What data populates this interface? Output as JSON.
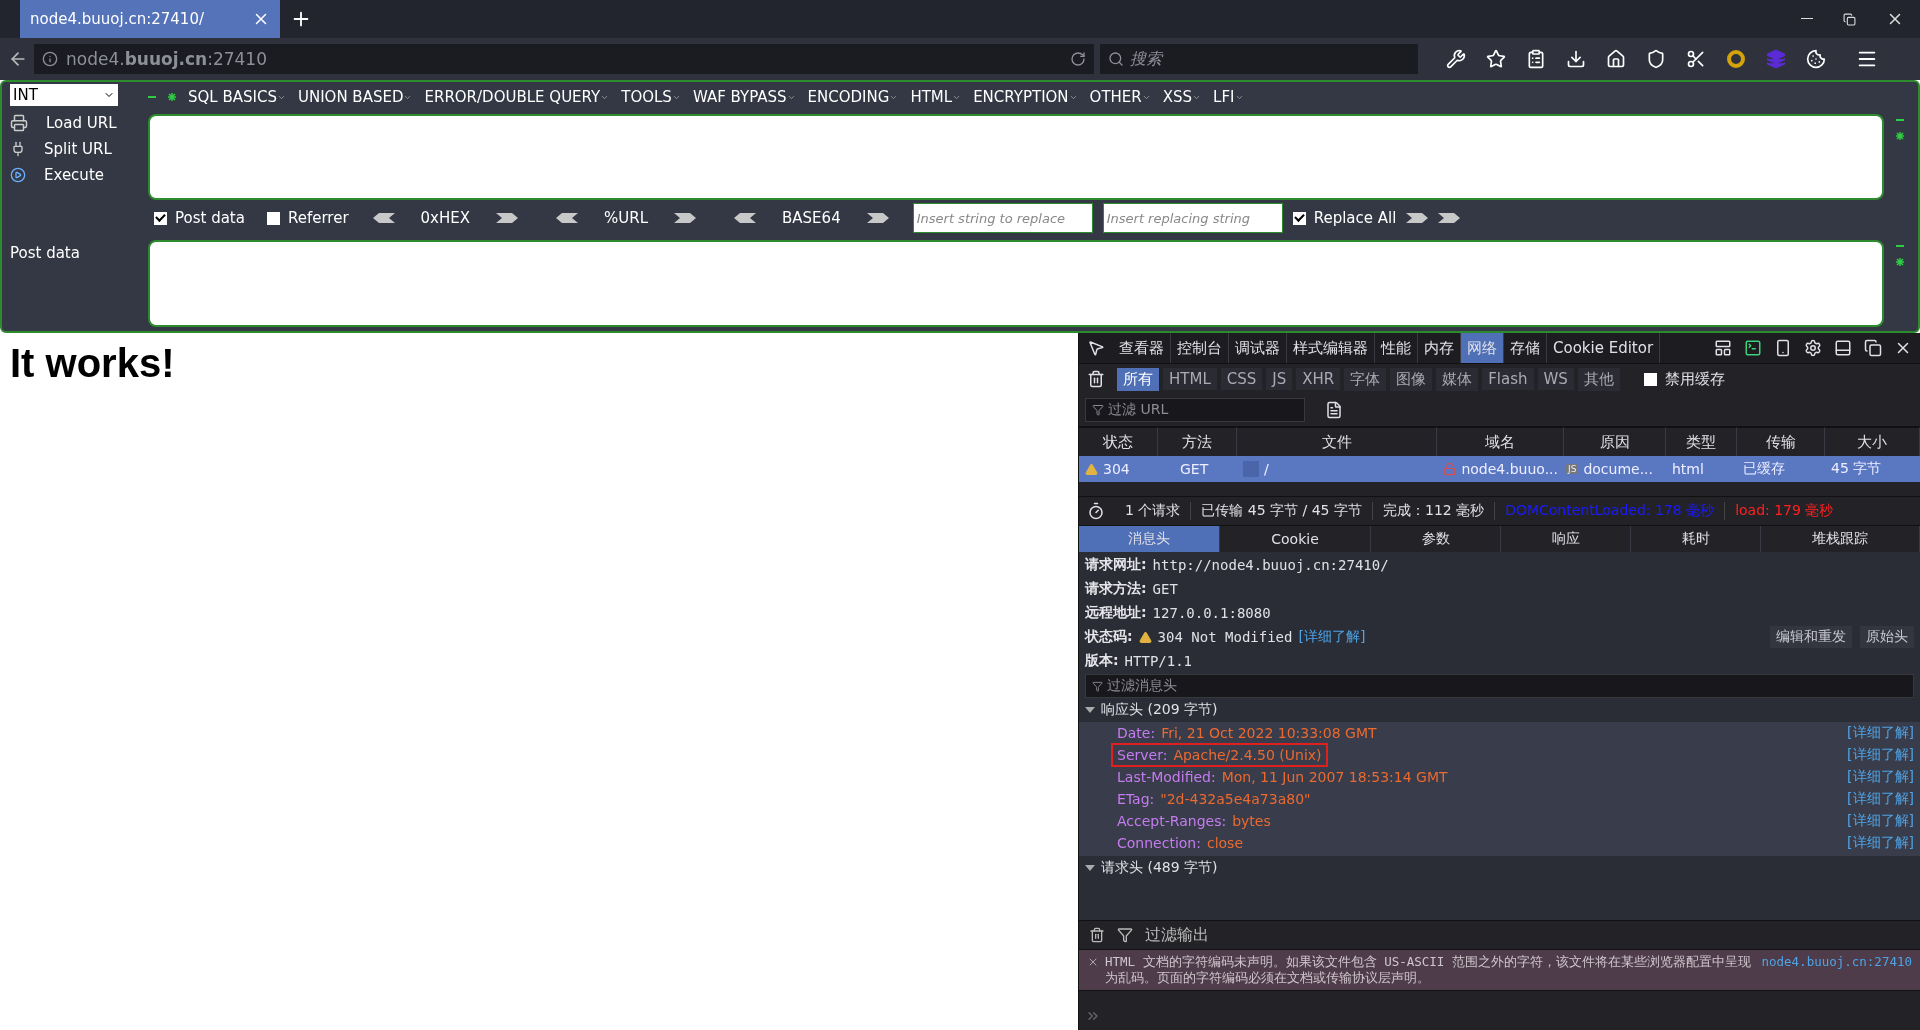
{
  "browser_tab": {
    "title": "node4.buuoj.cn:27410/",
    "selected": true
  },
  "address_bar": {
    "url": "node4.**buuoj.cn**:27410"
  },
  "search": {
    "placeholder": "搜索"
  },
  "hackbar": {
    "type_select": "INT",
    "menus": [
      "SQL BASICS",
      "UNION BASED",
      "ERROR/DOUBLE QUERY",
      "TOOLS",
      "WAF BYPASS",
      "ENCODING",
      "HTML",
      "ENCRYPTION",
      "OTHER",
      "XSS",
      "LFI"
    ],
    "actions": [
      {
        "label": "Load URL",
        "kind": "load"
      },
      {
        "label": "Split URL",
        "kind": "split"
      },
      {
        "label": "Execute",
        "kind": "execute"
      }
    ],
    "post_data_option": {
      "label": "Post data",
      "checked": true
    },
    "referrer_option": {
      "label": "Referrer",
      "checked": false
    },
    "encoders": [
      "0xHEX",
      "%URL",
      "BASE64"
    ],
    "replace_from": {
      "placeholder": "Insert string to replace"
    },
    "replace_to": {
      "placeholder": "Insert replacing string"
    },
    "replace_all": {
      "label": "Replace All",
      "checked": true
    },
    "post_label": "Post data"
  },
  "page": {
    "heading": "It works!"
  },
  "devtools": {
    "tools": [
      {
        "label": "查看器",
        "selected": false
      },
      {
        "label": "控制台",
        "selected": false
      },
      {
        "label": "调试器",
        "selected": false
      },
      {
        "label": "样式编辑器",
        "selected": false
      },
      {
        "label": "性能",
        "selected": false
      },
      {
        "label": "内存",
        "selected": false
      },
      {
        "label": "网络",
        "selected": true
      },
      {
        "label": "存储",
        "selected": false
      },
      {
        "label": "Cookie Editor",
        "selected": false
      }
    ],
    "type_filters": [
      {
        "label": "所有",
        "selected": true
      },
      {
        "label": "HTML",
        "selected": false
      },
      {
        "label": "CSS",
        "selected": false
      },
      {
        "label": "JS",
        "selected": false
      },
      {
        "label": "XHR",
        "selected": false
      },
      {
        "label": "字体",
        "selected": false
      },
      {
        "label": "图像",
        "selected": false
      },
      {
        "label": "媒体",
        "selected": false
      },
      {
        "label": "Flash",
        "selected": false
      },
      {
        "label": "WS",
        "selected": false
      },
      {
        "label": "其他",
        "selected": false
      }
    ],
    "disable_cache": {
      "label": "禁用缓存",
      "checked": false
    },
    "url_filter": {
      "placeholder": "过滤 URL"
    },
    "columns": [
      "状态",
      "方法",
      "文件",
      "域名",
      "原因",
      "类型",
      "传输",
      "大小"
    ],
    "rows": [
      {
        "status": "304",
        "method": "GET",
        "file": "/",
        "domain": "node4.buuo...",
        "cause": "docume...",
        "cause_badge": "JS",
        "type": "html",
        "transferred": "已缓存",
        "size": "45 字节",
        "selected": true
      }
    ],
    "summary": [
      {
        "text": "1 个请求",
        "color": "#e0e0e6"
      },
      {
        "text": "已传输 45 字节 / 45 字节",
        "color": "#e0e0e6"
      },
      {
        "text": "完成：112 毫秒",
        "color": "#e0e0e6"
      },
      {
        "text": "DOMContentLoaded: 178 毫秒",
        "color": "#1a1aff"
      },
      {
        "text": "load: 179 毫秒",
        "color": "#ff2020"
      }
    ],
    "detail_tabs": [
      {
        "label": "消息头",
        "selected": true
      },
      {
        "label": "Cookie",
        "selected": false
      },
      {
        "label": "参数",
        "selected": false
      },
      {
        "label": "响应",
        "selected": false
      },
      {
        "label": "耗时",
        "selected": false
      },
      {
        "label": "堆栈跟踪",
        "selected": false
      }
    ],
    "request": [
      {
        "label": "请求网址:",
        "value": "http://node4.buuoj.cn:27410/"
      },
      {
        "label": "请求方法:",
        "value": "GET"
      },
      {
        "label": "远程地址:",
        "value": "127.0.0.1:8080"
      }
    ],
    "status_code": {
      "label": "状态码:",
      "value": "304 Not Modified",
      "link": "[详细了解]"
    },
    "version": {
      "label": "版本:",
      "value": "HTTP/1.1"
    },
    "header_buttons": [
      "编辑和重发",
      "原始头"
    ],
    "header_filter": {
      "placeholder": "过滤消息头"
    },
    "response_headers": {
      "title": "响应头 (209 字节)",
      "expanded": true,
      "headers": [
        {
          "name": "Date:",
          "value": "Fri, 21 Oct 2022 10:33:08 GMT",
          "link": "[详细了解]",
          "highlighted": false
        },
        {
          "name": "Server:",
          "value": "Apache/2.4.50 (Unix)",
          "link": "[详细了解]",
          "highlighted": true
        },
        {
          "name": "Last-Modified:",
          "value": "Mon, 11 Jun 2007 18:53:14 GMT",
          "link": "[详细了解]",
          "highlighted": false
        },
        {
          "name": "ETag:",
          "value": "\"2d-432a5e4a73a80\"",
          "link": "[详细了解]",
          "highlighted": false
        },
        {
          "name": "Accept-Ranges:",
          "value": "bytes",
          "link": "[详细了解]",
          "highlighted": false
        },
        {
          "name": "Connection:",
          "value": "close",
          "link": "[详细了解]",
          "highlighted": false
        }
      ]
    },
    "request_headers": {
      "title": "请求头 (489 字节)",
      "expanded": true
    },
    "console_filter": "过滤输出",
    "messages": [
      {
        "text": "HTML 文档的字符编码未声明。如果该文件包含 US-ASCII 范围之外的字符，该文件将在某些浏览器配置中呈现为乱码。页面的字符编码必须在文档或传输协议层声明。",
        "source": "node4.buuoj.cn:27410"
      }
    ]
  }
}
